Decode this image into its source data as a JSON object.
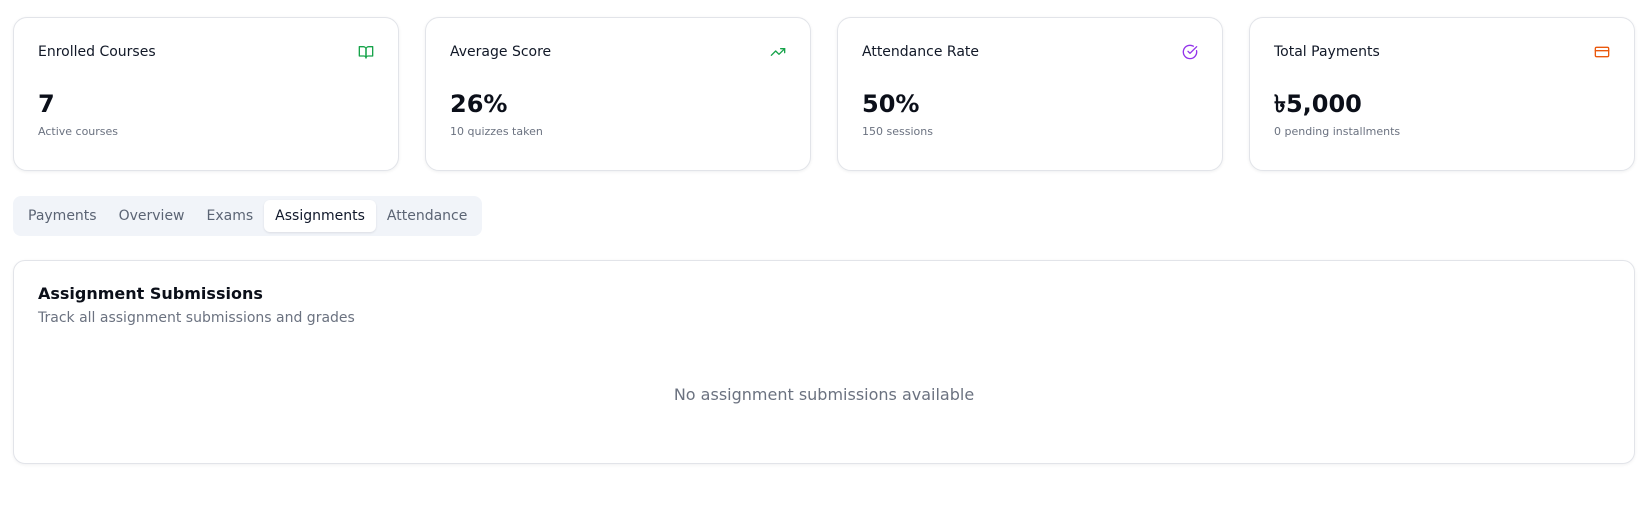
{
  "stats": [
    {
      "title": "Enrolled Courses",
      "value": "7",
      "sub": "Active courses",
      "icon": "book-open-icon",
      "icon_color": "#16a34a"
    },
    {
      "title": "Average Score",
      "value": "26%",
      "sub": "10 quizzes taken",
      "icon": "trending-up-icon",
      "icon_color": "#16a34a"
    },
    {
      "title": "Attendance Rate",
      "value": "50%",
      "sub": "150 sessions",
      "icon": "check-circle-icon",
      "icon_color": "#9333ea"
    },
    {
      "title": "Total Payments",
      "value": "৳5,000",
      "sub": "0 pending installments",
      "icon": "credit-card-icon",
      "icon_color": "#ea580c"
    }
  ],
  "tabs": [
    {
      "label": "Payments",
      "active": false
    },
    {
      "label": "Overview",
      "active": false
    },
    {
      "label": "Exams",
      "active": false
    },
    {
      "label": "Assignments",
      "active": true
    },
    {
      "label": "Attendance",
      "active": false
    }
  ],
  "panel": {
    "title": "Assignment Submissions",
    "description": "Track all assignment submissions and grades",
    "empty_message": "No assignment submissions available"
  }
}
